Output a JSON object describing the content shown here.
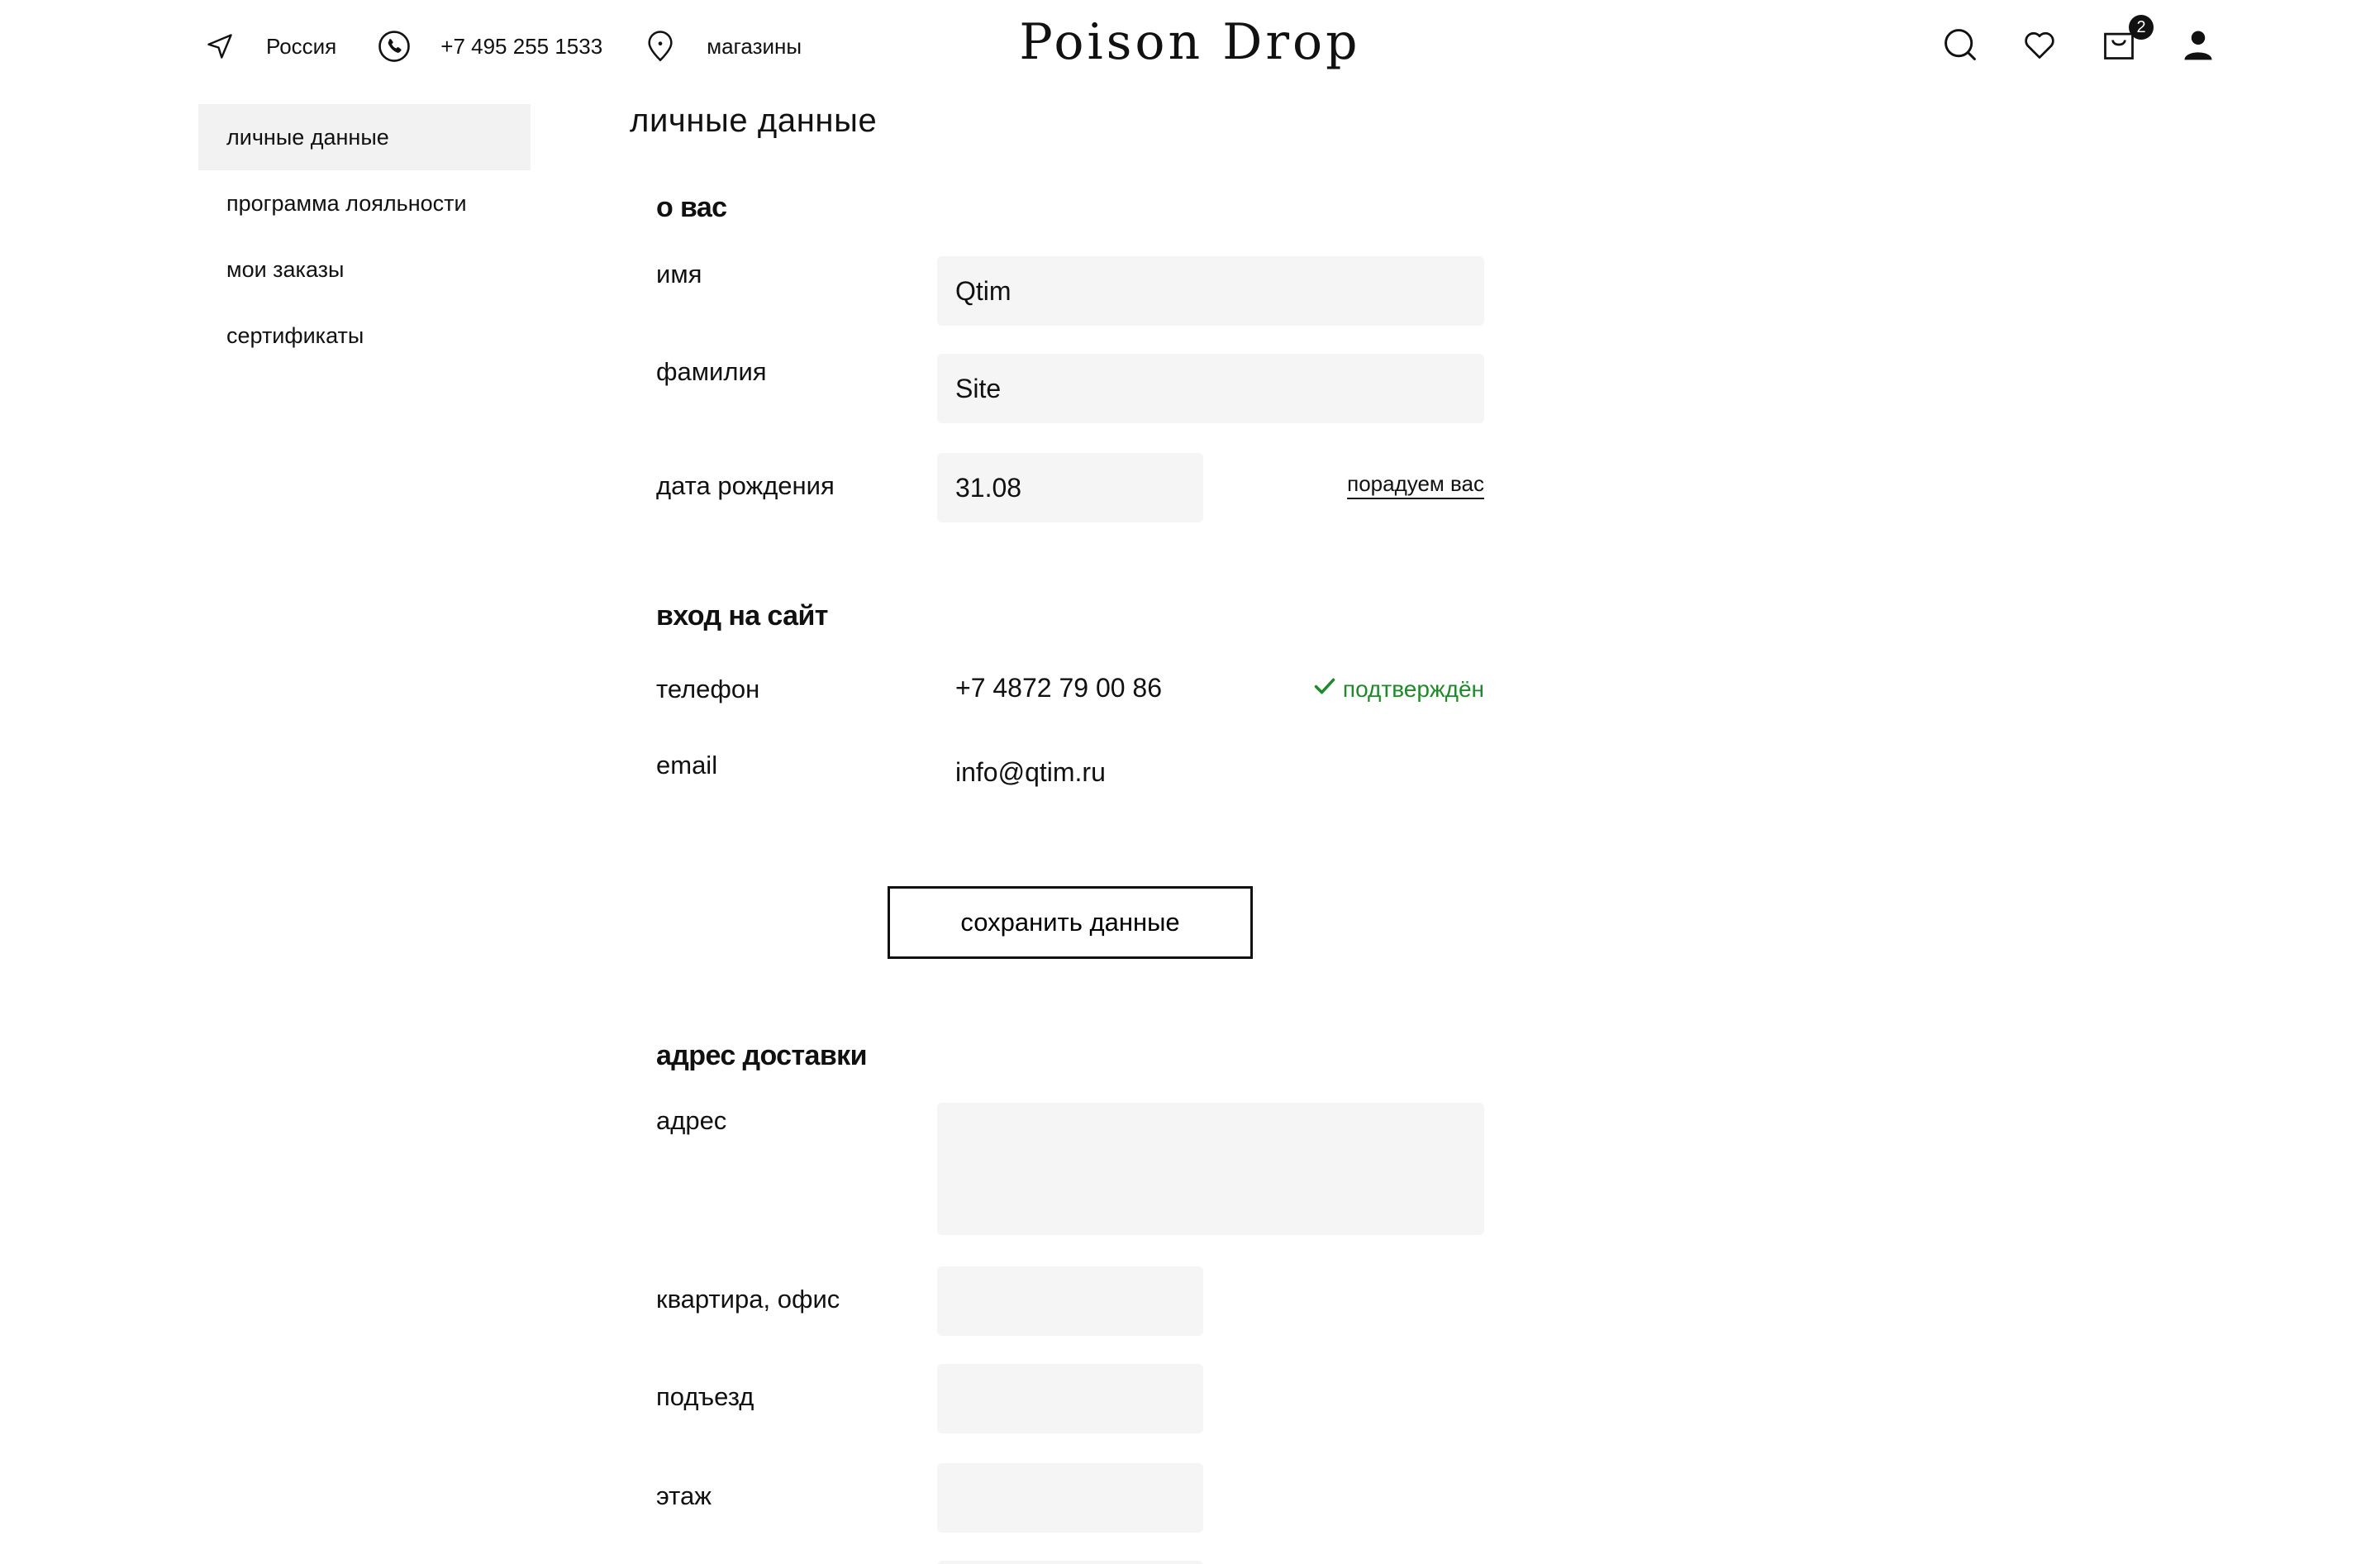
{
  "header": {
    "region": "Россия",
    "phone": "+7 495 255 1533",
    "stores": "магазины",
    "logo": "Poison Drop",
    "cart_count": "2"
  },
  "sidebar": {
    "items": [
      {
        "label": "личные данные",
        "active": true
      },
      {
        "label": "программа лояльности"
      },
      {
        "label": "мои заказы"
      },
      {
        "label": "сертификаты"
      }
    ]
  },
  "main": {
    "title": "личные данные",
    "about": {
      "title": "о вас",
      "first_name_label": "имя",
      "first_name_value": "Qtim",
      "last_name_label": "фамилия",
      "last_name_value": "Site",
      "birthday_label": "дата рождения",
      "birthday_value": "31.08",
      "birthday_link": "порадуем вас"
    },
    "login": {
      "title": "вход на сайт",
      "phone_label": "телефон",
      "phone_value": "+7 4872 79 00 86",
      "phone_status": "подтверждён",
      "email_label": "email",
      "email_value": "info@qtim.ru"
    },
    "save_button": "сохранить данные",
    "delivery": {
      "title": "адрес доставки",
      "address_label": "адрес",
      "address_value": "",
      "apartment_label": "квартира, офис",
      "apartment_value": "",
      "entrance_label": "подъезд",
      "entrance_value": "",
      "floor_label": "этаж",
      "floor_value": ""
    }
  },
  "colors": {
    "accent": "#111111",
    "verified": "#1f8a2a",
    "field_bg": "#f5f5f5",
    "active_bg": "#f2f2f2"
  }
}
